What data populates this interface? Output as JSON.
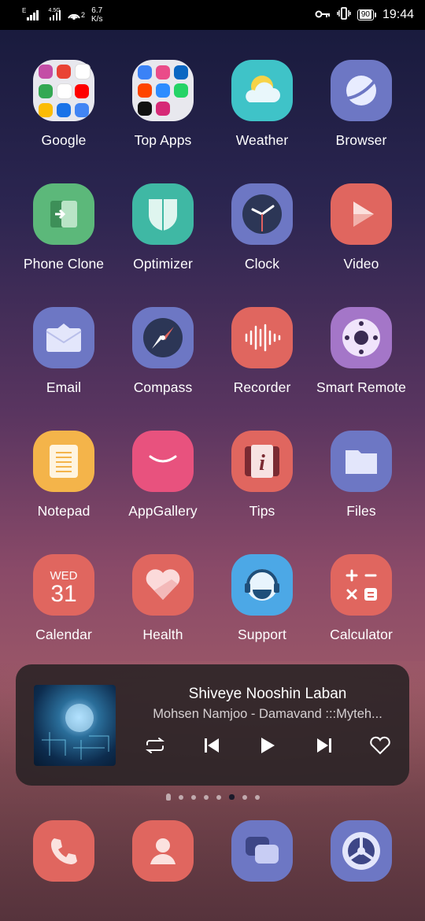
{
  "status": {
    "network_type": "E",
    "network_type2": "4.5G",
    "hotspot_count": "2",
    "speed_value": "6.7",
    "speed_unit": "K/s",
    "battery": "90",
    "time": "19:44",
    "icons": [
      "key-icon",
      "vibrate-icon"
    ]
  },
  "apps": [
    {
      "label": "Google",
      "icon": "google-folder"
    },
    {
      "label": "Top Apps",
      "icon": "top-apps-folder"
    },
    {
      "label": "Weather",
      "icon": "weather-icon"
    },
    {
      "label": "Browser",
      "icon": "browser-icon"
    },
    {
      "label": "Phone Clone",
      "icon": "phone-clone-icon"
    },
    {
      "label": "Optimizer",
      "icon": "optimizer-icon"
    },
    {
      "label": "Clock",
      "icon": "clock-icon"
    },
    {
      "label": "Video",
      "icon": "video-icon"
    },
    {
      "label": "Email",
      "icon": "email-icon"
    },
    {
      "label": "Compass",
      "icon": "compass-icon"
    },
    {
      "label": "Recorder",
      "icon": "recorder-icon"
    },
    {
      "label": "Smart Remote",
      "icon": "remote-icon"
    },
    {
      "label": "Notepad",
      "icon": "notepad-icon"
    },
    {
      "label": "AppGallery",
      "icon": "appgallery-icon"
    },
    {
      "label": "Tips",
      "icon": "tips-icon"
    },
    {
      "label": "Files",
      "icon": "files-icon"
    },
    {
      "label": "Calendar",
      "icon": "calendar-icon",
      "day": "WED",
      "date": "31"
    },
    {
      "label": "Health",
      "icon": "health-icon"
    },
    {
      "label": "Support",
      "icon": "support-icon"
    },
    {
      "label": "Calculator",
      "icon": "calculator-icon"
    }
  ],
  "player": {
    "title": "Shiveye Nooshin Laban",
    "artist": "Mohsen Namjoo - Damavand :::Myteh...",
    "controls": [
      "repeat-icon",
      "previous-icon",
      "play-icon",
      "next-icon",
      "heart-icon"
    ]
  },
  "page_indicator": {
    "count": 7,
    "active_index": 4
  },
  "dock": [
    "phone-icon",
    "contacts-icon",
    "messages-icon",
    "settings-icon"
  ],
  "colors": {
    "red": "#e0665f",
    "indigo": "#6d77c4",
    "green": "#5cb87a",
    "teal": "#3fb8a4",
    "pink": "#e8527e",
    "yellow": "#f4b44a",
    "sky": "#4ca8e6",
    "purple": "#a476c8"
  }
}
